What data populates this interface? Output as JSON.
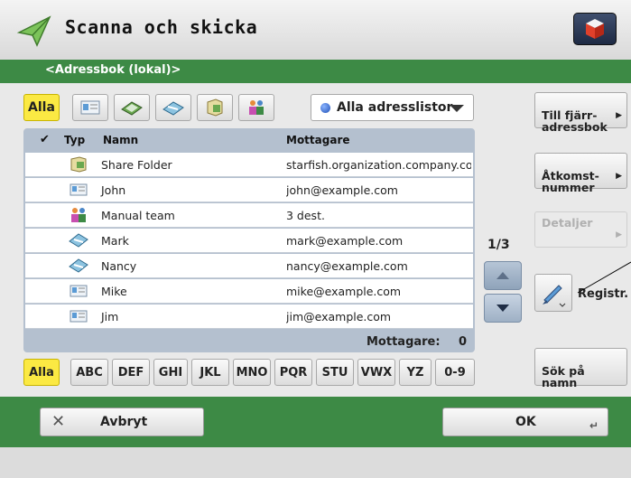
{
  "app": {
    "title": "Scanna och skicka"
  },
  "breadcrumb": "<Adressbok (lokal)>",
  "filters": {
    "all_label": "Alla",
    "icons": [
      "contact-card-icon",
      "fax-icon",
      "email-icon",
      "file-server-icon",
      "group-icon"
    ]
  },
  "dropdown": {
    "selected": "Alla adresslistor"
  },
  "list": {
    "headers": {
      "typ": "Typ",
      "namn": "Namn",
      "mottagare": "Mottagare"
    },
    "rows": [
      {
        "type_icon": "share-folder-icon",
        "name": "Share Folder",
        "dest": "starfish.organization.company.co"
      },
      {
        "type_icon": "contact-card-icon",
        "name": "John",
        "dest": "john@example.com"
      },
      {
        "type_icon": "group-icon",
        "name": "Manual team",
        "dest": "3 dest."
      },
      {
        "type_icon": "email-icon",
        "name": "Mark",
        "dest": "mark@example.com"
      },
      {
        "type_icon": "email-icon",
        "name": "Nancy",
        "dest": "nancy@example.com"
      },
      {
        "type_icon": "contact-card-icon",
        "name": "Mike",
        "dest": "mike@example.com"
      },
      {
        "type_icon": "contact-card-icon",
        "name": "Jim",
        "dest": "jim@example.com"
      }
    ],
    "recipients_label": "Mottagare:",
    "recipients_count": "0"
  },
  "pagination": {
    "indicator": "1/3"
  },
  "alpha_tabs": [
    "Alla",
    "ABC",
    "DEF",
    "GHI",
    "JKL",
    "MNO",
    "PQR",
    "STU",
    "VWX",
    "YZ",
    "0-9"
  ],
  "side": {
    "remote_book": "Till fjärr-\nadressbok",
    "access_number": "Åtkomst-\nnummer",
    "details": "Detaljer",
    "register": "Registr.",
    "search_name": "Sök på\nnamn"
  },
  "bottom": {
    "cancel": "Avbryt",
    "ok": "OK"
  },
  "colors": {
    "green": "#3d8a45",
    "yellow": "#fbe943",
    "panel": "#b4c0cf"
  }
}
